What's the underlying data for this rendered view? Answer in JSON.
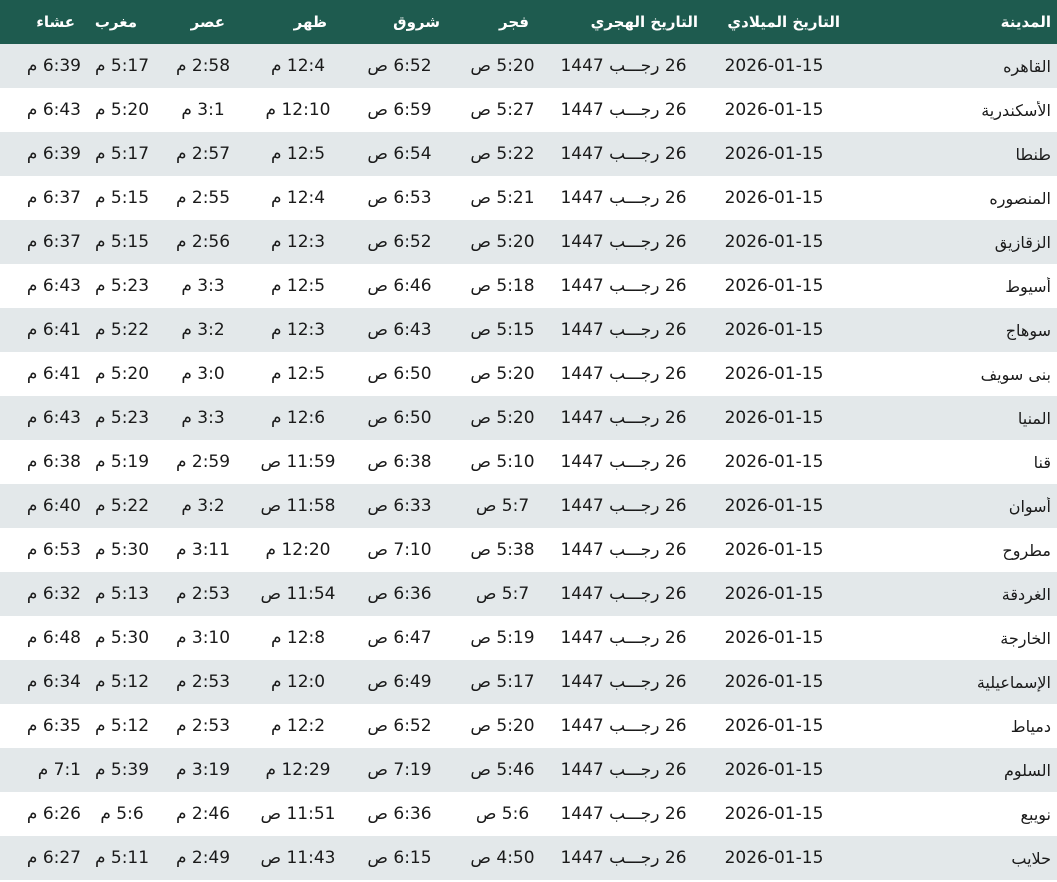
{
  "headers": {
    "city": "المدينة",
    "gregorian": "التاريخ الميلادي",
    "hijri": "التاريخ الهجري",
    "fajr": "فجر",
    "sunrise": "شروق",
    "dhuhr": "ظهر",
    "asr": "عصر",
    "maghrib": "مغرب",
    "isha": "عشاء"
  },
  "colors": {
    "header_bg": "#1e5b4f",
    "row_alt_bg": "#e3e8ea"
  },
  "rows": [
    {
      "city": "القاهره",
      "greg": "2026-01-15",
      "hijri": "26 رجـــب 1447",
      "fajr": "5:20 ص",
      "sunrise": "6:52 ص",
      "dhuhr": "12:4 م",
      "asr": "2:58 م",
      "maghrib": "5:17 م",
      "isha": "6:39 م"
    },
    {
      "city": "الأسكندرية",
      "greg": "2026-01-15",
      "hijri": "26 رجـــب 1447",
      "fajr": "5:27 ص",
      "sunrise": "6:59 ص",
      "dhuhr": "12:10 م",
      "asr": "3:1 م",
      "maghrib": "5:20 م",
      "isha": "6:43 م"
    },
    {
      "city": "طنطا",
      "greg": "2026-01-15",
      "hijri": "26 رجـــب 1447",
      "fajr": "5:22 ص",
      "sunrise": "6:54 ص",
      "dhuhr": "12:5 م",
      "asr": "2:57 م",
      "maghrib": "5:17 م",
      "isha": "6:39 م"
    },
    {
      "city": "المنصوره",
      "greg": "2026-01-15",
      "hijri": "26 رجـــب 1447",
      "fajr": "5:21 ص",
      "sunrise": "6:53 ص",
      "dhuhr": "12:4 م",
      "asr": "2:55 م",
      "maghrib": "5:15 م",
      "isha": "6:37 م"
    },
    {
      "city": "الزقازيق",
      "greg": "2026-01-15",
      "hijri": "26 رجـــب 1447",
      "fajr": "5:20 ص",
      "sunrise": "6:52 ص",
      "dhuhr": "12:3 م",
      "asr": "2:56 م",
      "maghrib": "5:15 م",
      "isha": "6:37 م"
    },
    {
      "city": "أسيوط",
      "greg": "2026-01-15",
      "hijri": "26 رجـــب 1447",
      "fajr": "5:18 ص",
      "sunrise": "6:46 ص",
      "dhuhr": "12:5 م",
      "asr": "3:3 م",
      "maghrib": "5:23 م",
      "isha": "6:43 م"
    },
    {
      "city": "سوهاج",
      "greg": "2026-01-15",
      "hijri": "26 رجـــب 1447",
      "fajr": "5:15 ص",
      "sunrise": "6:43 ص",
      "dhuhr": "12:3 م",
      "asr": "3:2 م",
      "maghrib": "5:22 م",
      "isha": "6:41 م"
    },
    {
      "city": "بنى سويف",
      "greg": "2026-01-15",
      "hijri": "26 رجـــب 1447",
      "fajr": "5:20 ص",
      "sunrise": "6:50 ص",
      "dhuhr": "12:5 م",
      "asr": "3:0 م",
      "maghrib": "5:20 م",
      "isha": "6:41 م"
    },
    {
      "city": "المنيا",
      "greg": "2026-01-15",
      "hijri": "26 رجـــب 1447",
      "fajr": "5:20 ص",
      "sunrise": "6:50 ص",
      "dhuhr": "12:6 م",
      "asr": "3:3 م",
      "maghrib": "5:23 م",
      "isha": "6:43 م"
    },
    {
      "city": "قنا",
      "greg": "2026-01-15",
      "hijri": "26 رجـــب 1447",
      "fajr": "5:10 ص",
      "sunrise": "6:38 ص",
      "dhuhr": "11:59 ص",
      "asr": "2:59 م",
      "maghrib": "5:19 م",
      "isha": "6:38 م"
    },
    {
      "city": "أسوان",
      "greg": "2026-01-15",
      "hijri": "26 رجـــب 1447",
      "fajr": "5:7 ص",
      "sunrise": "6:33 ص",
      "dhuhr": "11:58 ص",
      "asr": "3:2 م",
      "maghrib": "5:22 م",
      "isha": "6:40 م"
    },
    {
      "city": "مطروح",
      "greg": "2026-01-15",
      "hijri": "26 رجـــب 1447",
      "fajr": "5:38 ص",
      "sunrise": "7:10 ص",
      "dhuhr": "12:20 م",
      "asr": "3:11 م",
      "maghrib": "5:30 م",
      "isha": "6:53 م"
    },
    {
      "city": "الغردقة",
      "greg": "2026-01-15",
      "hijri": "26 رجـــب 1447",
      "fajr": "5:7 ص",
      "sunrise": "6:36 ص",
      "dhuhr": "11:54 ص",
      "asr": "2:53 م",
      "maghrib": "5:13 م",
      "isha": "6:32 م"
    },
    {
      "city": "الخارجة",
      "greg": "2026-01-15",
      "hijri": "26 رجـــب 1447",
      "fajr": "5:19 ص",
      "sunrise": "6:47 ص",
      "dhuhr": "12:8 م",
      "asr": "3:10 م",
      "maghrib": "5:30 م",
      "isha": "6:48 م"
    },
    {
      "city": "الإسماعيلية",
      "greg": "2026-01-15",
      "hijri": "26 رجـــب 1447",
      "fajr": "5:17 ص",
      "sunrise": "6:49 ص",
      "dhuhr": "12:0 م",
      "asr": "2:53 م",
      "maghrib": "5:12 م",
      "isha": "6:34 م"
    },
    {
      "city": "دمياط",
      "greg": "2026-01-15",
      "hijri": "26 رجـــب 1447",
      "fajr": "5:20 ص",
      "sunrise": "6:52 ص",
      "dhuhr": "12:2 م",
      "asr": "2:53 م",
      "maghrib": "5:12 م",
      "isha": "6:35 م"
    },
    {
      "city": "السلوم",
      "greg": "2026-01-15",
      "hijri": "26 رجـــب 1447",
      "fajr": "5:46 ص",
      "sunrise": "7:19 ص",
      "dhuhr": "12:29 م",
      "asr": "3:19 م",
      "maghrib": "5:39 م",
      "isha": "7:1 م"
    },
    {
      "city": "نويبع",
      "greg": "2026-01-15",
      "hijri": "26 رجـــب 1447",
      "fajr": "5:6 ص",
      "sunrise": "6:36 ص",
      "dhuhr": "11:51 ص",
      "asr": "2:46 م",
      "maghrib": "5:6 م",
      "isha": "6:26 م"
    },
    {
      "city": "حلايب",
      "greg": "2026-01-15",
      "hijri": "26 رجـــب 1447",
      "fajr": "4:50 ص",
      "sunrise": "6:15 ص",
      "dhuhr": "11:43 ص",
      "asr": "2:49 م",
      "maghrib": "5:11 م",
      "isha": "6:27 م"
    }
  ]
}
